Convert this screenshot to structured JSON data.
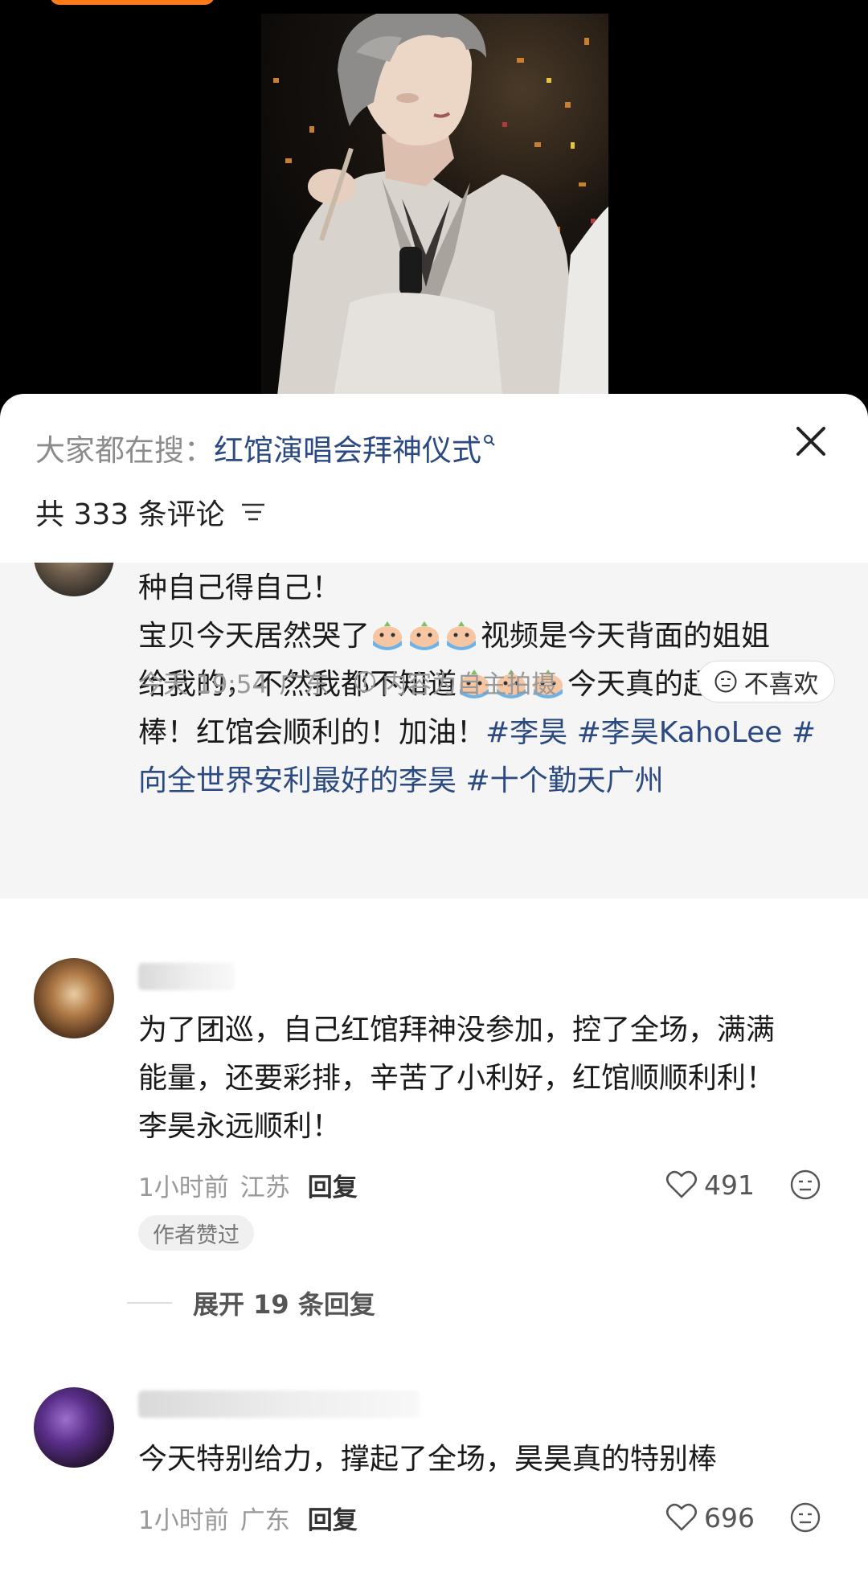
{
  "search": {
    "prefix": "大家都在搜：",
    "term": "红馆演唱会拜神仪式"
  },
  "comments_header": {
    "count_label": "共 333 条评论"
  },
  "pinned_comment": {
    "line1": "种自己得自己！",
    "line2a": "宝贝今天居然哭了",
    "line2b": "视频是今天背面的姐姐",
    "line3a": "给我的，不然我都不知道",
    "line3b": "今天真的超级",
    "line4a": "棒！红馆会顺利的！加油！",
    "hashtag1": "#李昊",
    "hashtag2": "#李昊KahoLee",
    "hashtag3a": "#",
    "hashtag3b": "向全世界安利最好的李昊",
    "hashtag4": "#十个勤天广州",
    "time": "今天 19:54",
    "location": "广东",
    "notice": "内容为自主拍摄",
    "dislike_label": "不喜欢"
  },
  "comments": [
    {
      "line1": "为了团巡，自己红馆拜神没参加，控了全场，满满",
      "line2": "能量，还要彩排，辛苦了小利好，红馆顺顺利利！",
      "line3": "李昊永远顺利！",
      "time": "1小时前",
      "location": "江苏",
      "reply_label": "回复",
      "likes": "491",
      "author_badge": "作者赞过",
      "expand_label": "展开 19 条回复"
    },
    {
      "line1": "今天特别给力，撑起了全场，昊昊真的特别棒",
      "time": "1小时前",
      "location": "广东",
      "reply_label": "回复",
      "likes": "696"
    }
  ],
  "icons": {
    "close": "close-icon",
    "sort": "sort-filter-icon",
    "info": "info-circle-icon",
    "like": "heart-outline-icon",
    "react": "neutral-face-icon",
    "emoji": "crying-emoji-icon"
  },
  "colors": {
    "link": "#2c4a82",
    "accent_pill": "#ff7a18",
    "pinned_bg": "#f5f5f5"
  }
}
